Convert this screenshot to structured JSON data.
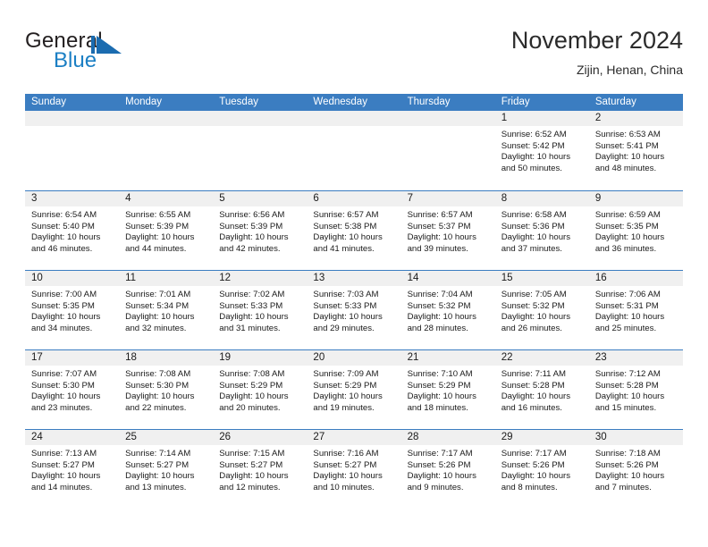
{
  "brand": {
    "name_part1": "General",
    "name_part2": "Blue",
    "mark": "sail-triangle-logo"
  },
  "header": {
    "title": "November 2024",
    "subtitle": "Zijin, Henan, China"
  },
  "colors": {
    "header_blue": "#3b7dc1",
    "date_band_gray": "#f0f0f0",
    "brand_blue": "#1b7fc4",
    "text": "#1a1a1a"
  },
  "weekdays": [
    "Sunday",
    "Monday",
    "Tuesday",
    "Wednesday",
    "Thursday",
    "Friday",
    "Saturday"
  ],
  "labels": {
    "sunrise_prefix": "Sunrise:",
    "sunset_prefix": "Sunset:",
    "daylight_prefix": "Daylight:"
  },
  "weeks": [
    [
      {
        "day": "",
        "empty": true
      },
      {
        "day": "",
        "empty": true
      },
      {
        "day": "",
        "empty": true
      },
      {
        "day": "",
        "empty": true
      },
      {
        "day": "",
        "empty": true
      },
      {
        "day": "1",
        "sunrise": "Sunrise: 6:52 AM",
        "sunset": "Sunset: 5:42 PM",
        "daylight_1": "Daylight: 10 hours",
        "daylight_2": "and 50 minutes."
      },
      {
        "day": "2",
        "sunrise": "Sunrise: 6:53 AM",
        "sunset": "Sunset: 5:41 PM",
        "daylight_1": "Daylight: 10 hours",
        "daylight_2": "and 48 minutes."
      }
    ],
    [
      {
        "day": "3",
        "sunrise": "Sunrise: 6:54 AM",
        "sunset": "Sunset: 5:40 PM",
        "daylight_1": "Daylight: 10 hours",
        "daylight_2": "and 46 minutes."
      },
      {
        "day": "4",
        "sunrise": "Sunrise: 6:55 AM",
        "sunset": "Sunset: 5:39 PM",
        "daylight_1": "Daylight: 10 hours",
        "daylight_2": "and 44 minutes."
      },
      {
        "day": "5",
        "sunrise": "Sunrise: 6:56 AM",
        "sunset": "Sunset: 5:39 PM",
        "daylight_1": "Daylight: 10 hours",
        "daylight_2": "and 42 minutes."
      },
      {
        "day": "6",
        "sunrise": "Sunrise: 6:57 AM",
        "sunset": "Sunset: 5:38 PM",
        "daylight_1": "Daylight: 10 hours",
        "daylight_2": "and 41 minutes."
      },
      {
        "day": "7",
        "sunrise": "Sunrise: 6:57 AM",
        "sunset": "Sunset: 5:37 PM",
        "daylight_1": "Daylight: 10 hours",
        "daylight_2": "and 39 minutes."
      },
      {
        "day": "8",
        "sunrise": "Sunrise: 6:58 AM",
        "sunset": "Sunset: 5:36 PM",
        "daylight_1": "Daylight: 10 hours",
        "daylight_2": "and 37 minutes."
      },
      {
        "day": "9",
        "sunrise": "Sunrise: 6:59 AM",
        "sunset": "Sunset: 5:35 PM",
        "daylight_1": "Daylight: 10 hours",
        "daylight_2": "and 36 minutes."
      }
    ],
    [
      {
        "day": "10",
        "sunrise": "Sunrise: 7:00 AM",
        "sunset": "Sunset: 5:35 PM",
        "daylight_1": "Daylight: 10 hours",
        "daylight_2": "and 34 minutes."
      },
      {
        "day": "11",
        "sunrise": "Sunrise: 7:01 AM",
        "sunset": "Sunset: 5:34 PM",
        "daylight_1": "Daylight: 10 hours",
        "daylight_2": "and 32 minutes."
      },
      {
        "day": "12",
        "sunrise": "Sunrise: 7:02 AM",
        "sunset": "Sunset: 5:33 PM",
        "daylight_1": "Daylight: 10 hours",
        "daylight_2": "and 31 minutes."
      },
      {
        "day": "13",
        "sunrise": "Sunrise: 7:03 AM",
        "sunset": "Sunset: 5:33 PM",
        "daylight_1": "Daylight: 10 hours",
        "daylight_2": "and 29 minutes."
      },
      {
        "day": "14",
        "sunrise": "Sunrise: 7:04 AM",
        "sunset": "Sunset: 5:32 PM",
        "daylight_1": "Daylight: 10 hours",
        "daylight_2": "and 28 minutes."
      },
      {
        "day": "15",
        "sunrise": "Sunrise: 7:05 AM",
        "sunset": "Sunset: 5:32 PM",
        "daylight_1": "Daylight: 10 hours",
        "daylight_2": "and 26 minutes."
      },
      {
        "day": "16",
        "sunrise": "Sunrise: 7:06 AM",
        "sunset": "Sunset: 5:31 PM",
        "daylight_1": "Daylight: 10 hours",
        "daylight_2": "and 25 minutes."
      }
    ],
    [
      {
        "day": "17",
        "sunrise": "Sunrise: 7:07 AM",
        "sunset": "Sunset: 5:30 PM",
        "daylight_1": "Daylight: 10 hours",
        "daylight_2": "and 23 minutes."
      },
      {
        "day": "18",
        "sunrise": "Sunrise: 7:08 AM",
        "sunset": "Sunset: 5:30 PM",
        "daylight_1": "Daylight: 10 hours",
        "daylight_2": "and 22 minutes."
      },
      {
        "day": "19",
        "sunrise": "Sunrise: 7:08 AM",
        "sunset": "Sunset: 5:29 PM",
        "daylight_1": "Daylight: 10 hours",
        "daylight_2": "and 20 minutes."
      },
      {
        "day": "20",
        "sunrise": "Sunrise: 7:09 AM",
        "sunset": "Sunset: 5:29 PM",
        "daylight_1": "Daylight: 10 hours",
        "daylight_2": "and 19 minutes."
      },
      {
        "day": "21",
        "sunrise": "Sunrise: 7:10 AM",
        "sunset": "Sunset: 5:29 PM",
        "daylight_1": "Daylight: 10 hours",
        "daylight_2": "and 18 minutes."
      },
      {
        "day": "22",
        "sunrise": "Sunrise: 7:11 AM",
        "sunset": "Sunset: 5:28 PM",
        "daylight_1": "Daylight: 10 hours",
        "daylight_2": "and 16 minutes."
      },
      {
        "day": "23",
        "sunrise": "Sunrise: 7:12 AM",
        "sunset": "Sunset: 5:28 PM",
        "daylight_1": "Daylight: 10 hours",
        "daylight_2": "and 15 minutes."
      }
    ],
    [
      {
        "day": "24",
        "sunrise": "Sunrise: 7:13 AM",
        "sunset": "Sunset: 5:27 PM",
        "daylight_1": "Daylight: 10 hours",
        "daylight_2": "and 14 minutes."
      },
      {
        "day": "25",
        "sunrise": "Sunrise: 7:14 AM",
        "sunset": "Sunset: 5:27 PM",
        "daylight_1": "Daylight: 10 hours",
        "daylight_2": "and 13 minutes."
      },
      {
        "day": "26",
        "sunrise": "Sunrise: 7:15 AM",
        "sunset": "Sunset: 5:27 PM",
        "daylight_1": "Daylight: 10 hours",
        "daylight_2": "and 12 minutes."
      },
      {
        "day": "27",
        "sunrise": "Sunrise: 7:16 AM",
        "sunset": "Sunset: 5:27 PM",
        "daylight_1": "Daylight: 10 hours",
        "daylight_2": "and 10 minutes."
      },
      {
        "day": "28",
        "sunrise": "Sunrise: 7:17 AM",
        "sunset": "Sunset: 5:26 PM",
        "daylight_1": "Daylight: 10 hours",
        "daylight_2": "and 9 minutes."
      },
      {
        "day": "29",
        "sunrise": "Sunrise: 7:17 AM",
        "sunset": "Sunset: 5:26 PM",
        "daylight_1": "Daylight: 10 hours",
        "daylight_2": "and 8 minutes."
      },
      {
        "day": "30",
        "sunrise": "Sunrise: 7:18 AM",
        "sunset": "Sunset: 5:26 PM",
        "daylight_1": "Daylight: 10 hours",
        "daylight_2": "and 7 minutes."
      }
    ]
  ]
}
